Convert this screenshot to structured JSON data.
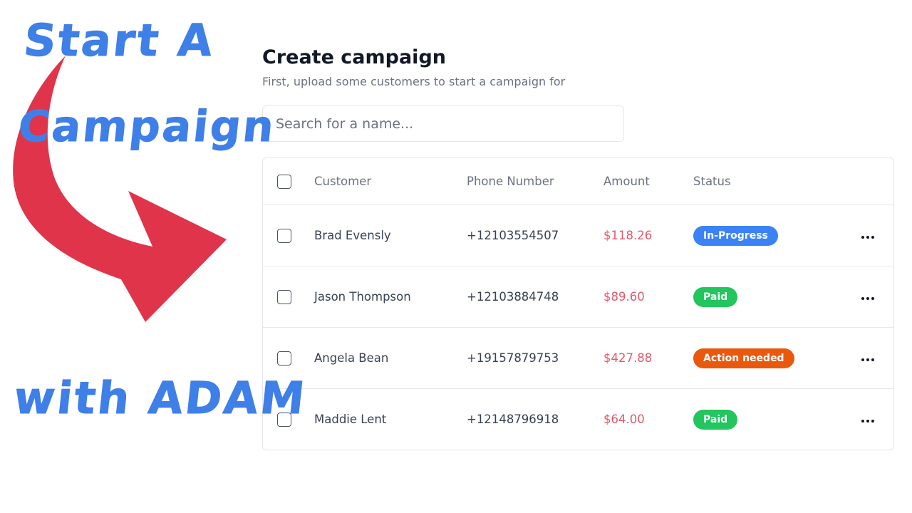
{
  "promo": {
    "line1": "Start A",
    "line2": "Campaign",
    "line3": "with ADAM",
    "text_color": "#3f7fe8",
    "arrow_color": "#e0344a"
  },
  "header": {
    "title": "Create campaign",
    "subtitle": "First, upload some customers to start a campaign for"
  },
  "search": {
    "placeholder": "Search for a name..."
  },
  "table": {
    "columns": {
      "customer": "Customer",
      "phone": "Phone Number",
      "amount": "Amount",
      "status": "Status"
    },
    "rows": [
      {
        "customer": "Brad Evensly",
        "phone": "+12103554507",
        "amount": "$118.26",
        "status": "In-Progress",
        "status_color": "#3b82f6"
      },
      {
        "customer": "Jason Thompson",
        "phone": "+12103884748",
        "amount": "$89.60",
        "status": "Paid",
        "status_color": "#22c55e"
      },
      {
        "customer": "Angela Bean",
        "phone": "+19157879753",
        "amount": "$427.88",
        "status": "Action needed",
        "status_color": "#ea580c"
      },
      {
        "customer": "Maddie Lent",
        "phone": "+12148796918",
        "amount": "$64.00",
        "status": "Paid",
        "status_color": "#22c55e"
      }
    ]
  },
  "colors": {
    "amount": "#e05a6b",
    "title": "#111827",
    "muted": "#6b7280"
  }
}
